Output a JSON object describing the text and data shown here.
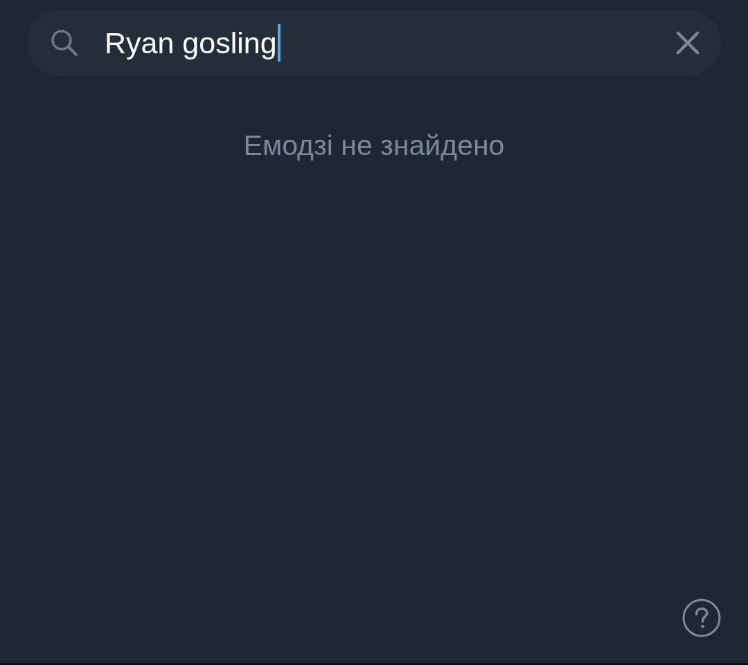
{
  "search": {
    "value": "Ryan gosling",
    "focused": true
  },
  "empty_message": "Емодзі не знайдено"
}
